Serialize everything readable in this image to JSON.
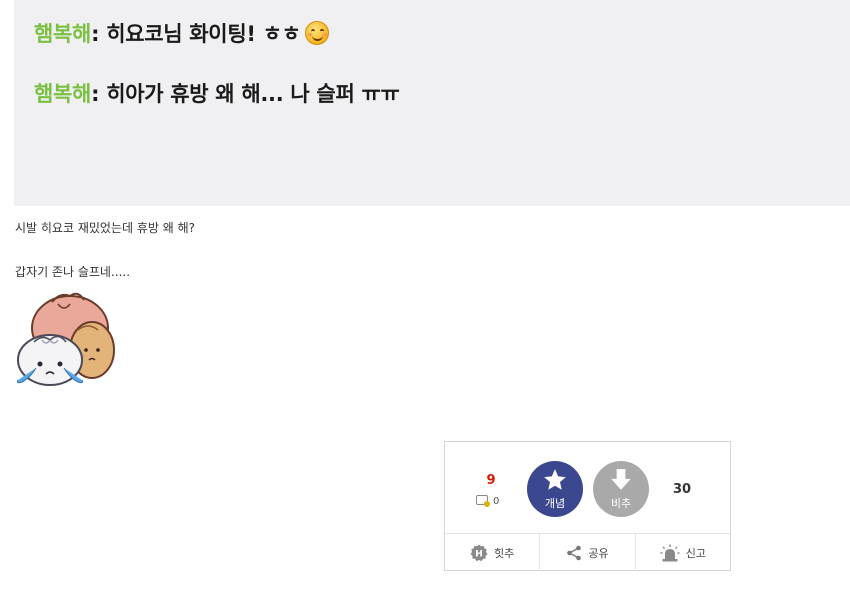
{
  "chat": {
    "lines": [
      {
        "name": "햄복해",
        "separator": ":",
        "message": "히요코님 화이팅! ㅎㅎ",
        "emoji": "smiling-emoji-icon"
      },
      {
        "name": "햄복해",
        "separator": ":",
        "message": "히아가 휴방 왜 해... 나 슬퍼 ㅠㅠ"
      }
    ],
    "name_color": "#7bc043",
    "background": "#f0f0f2"
  },
  "post": {
    "line1": "시발 히요코 재밌었는데 휴방 왜 해?",
    "line2": "갑자기 존나 슬프네.....",
    "sticker": "crying-dumplings-sticker"
  },
  "recommend": {
    "up_count": "9",
    "fix_count": "0",
    "up_label": "개념",
    "down_label": "비추",
    "down_count": "30",
    "up_color": "#3b4890",
    "down_color": "#a9a9a9",
    "count_color": "#d31900",
    "actions": [
      {
        "label": "힛추",
        "icon": "hit-badge-icon"
      },
      {
        "label": "공유",
        "icon": "share-icon"
      },
      {
        "label": "신고",
        "icon": "siren-icon"
      }
    ]
  }
}
